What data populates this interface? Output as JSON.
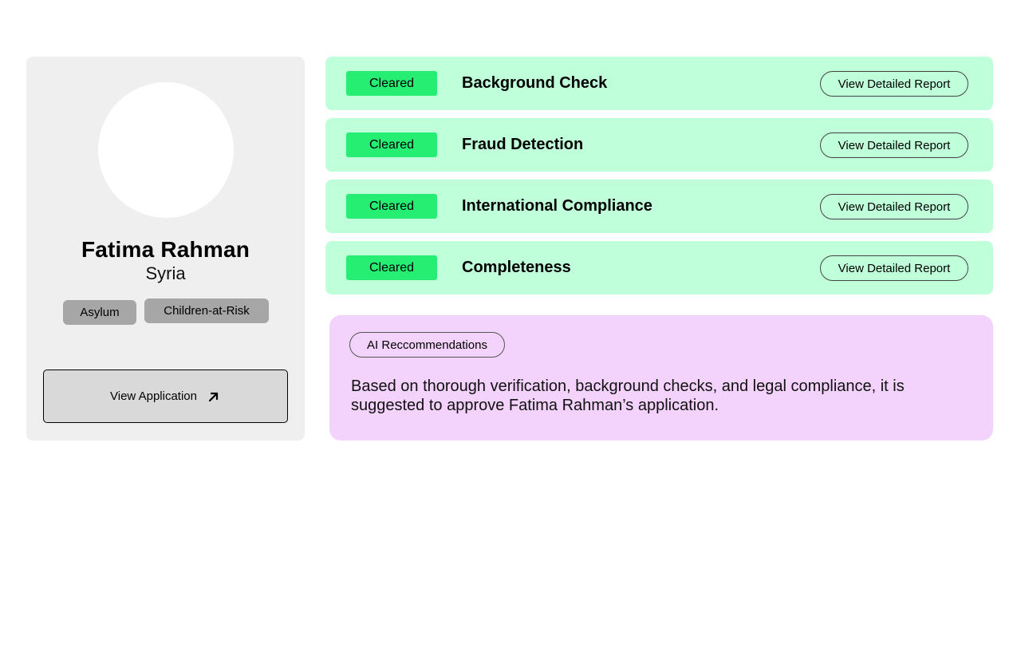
{
  "profile": {
    "name": "Fatima Rahman",
    "country": "Syria",
    "tags": [
      "Asylum",
      "Children-at-Risk"
    ],
    "view_application_label": "View Application",
    "view_application_icon": "arrow-up-right-icon"
  },
  "checks": [
    {
      "status": "Cleared",
      "title": "Background Check",
      "report_label": "View Detailed Report"
    },
    {
      "status": "Cleared",
      "title": "Fraud Detection",
      "report_label": "View Detailed Report"
    },
    {
      "status": "Cleared",
      "title": "International Compliance",
      "report_label": "View Detailed Report"
    },
    {
      "status": "Cleared",
      "title": "Completeness",
      "report_label": "View Detailed Report"
    }
  ],
  "ai_recommendation": {
    "label": "AI Reccommendations",
    "text": "Based on thorough verification, background checks, and legal compliance, it is suggested to approve Fatima Rahman’s application."
  },
  "colors": {
    "profile_card_bg": "#efefef",
    "check_row_bg": "#bfffd9",
    "cleared_badge": "#25ee72",
    "ai_card_bg": "#f3d3fc",
    "tag_bg": "#a6a6a6",
    "button_bg": "#d9d9d9"
  }
}
